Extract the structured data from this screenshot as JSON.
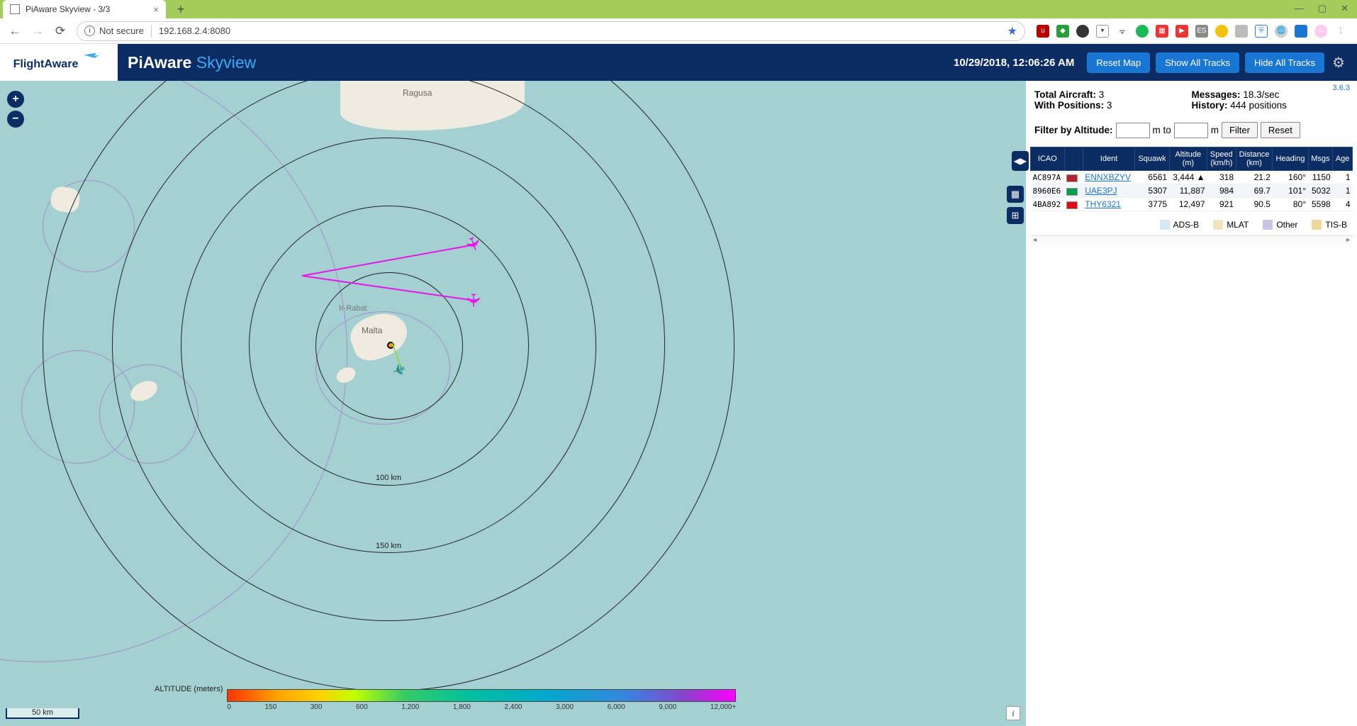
{
  "browser": {
    "tab_title": "PiAware Skyview - 3/3",
    "insecure_label": "Not secure",
    "url": "192.168.2.4:8080"
  },
  "header": {
    "title_a": "PiAware",
    "title_b": "Skyview",
    "timestamp": "10/29/2018, 12:06:26 AM",
    "btn_reset": "Reset Map",
    "btn_show": "Show All Tracks",
    "btn_hide": "Hide All Tracks"
  },
  "panel": {
    "version": "3.6.3",
    "total_label": "Total Aircraft:",
    "total_value": "3",
    "withpos_label": "With Positions:",
    "withpos_value": "3",
    "messages_label": "Messages:",
    "messages_value": "18.3/sec",
    "history_label": "History:",
    "history_value": "444 positions",
    "filter_label": "Filter by Altitude:",
    "filter_unit1": "m to",
    "filter_unit2": "m",
    "filter_btn": "Filter",
    "reset_btn": "Reset",
    "columns": [
      "ICAO",
      "",
      "Ident",
      "Squawk",
      "Altitude (m)",
      "Speed (km/h)",
      "Distance (km)",
      "Heading",
      "Msgs",
      "Age"
    ],
    "rows": [
      {
        "icao": "AC897A",
        "flag": "#b22234",
        "ident": "ENNXBZYV",
        "squawk": "6561",
        "alt": "3,444 ▲",
        "speed": "318",
        "dist": "21.2",
        "hdg": "160°",
        "msgs": "1150",
        "age": "1"
      },
      {
        "icao": "8960E6",
        "flag": "#009e49",
        "ident": "UAE3PJ",
        "squawk": "5307",
        "alt": "11,887",
        "speed": "984",
        "dist": "69.7",
        "hdg": "101°",
        "msgs": "5032",
        "age": "1"
      },
      {
        "icao": "4BA892",
        "flag": "#e30a17",
        "ident": "THY6321",
        "squawk": "3775",
        "alt": "12,497",
        "speed": "921",
        "dist": "90.5",
        "hdg": "80°",
        "msgs": "5598",
        "age": "4"
      }
    ],
    "legend": [
      {
        "label": "ADS-B",
        "color": "#d5e8f7"
      },
      {
        "label": "MLAT",
        "color": "#f2e3c0"
      },
      {
        "label": "Other",
        "color": "#c9c3e6"
      },
      {
        "label": "TIS-B",
        "color": "#f0d79a"
      }
    ]
  },
  "map": {
    "scale": "50 km",
    "ring100": "100 km",
    "ring150": "150 km",
    "place_ragusa": "Ragusa",
    "place_rabat": "Ir-Rabat",
    "place_malta": "Malta",
    "alt_label": "ALTITUDE (meters)",
    "alt_ticks": [
      "0",
      "150",
      "300",
      "600",
      "1,200",
      "1,800",
      "2,400",
      "3,000",
      "6,000",
      "9,000",
      "12,000+"
    ]
  }
}
